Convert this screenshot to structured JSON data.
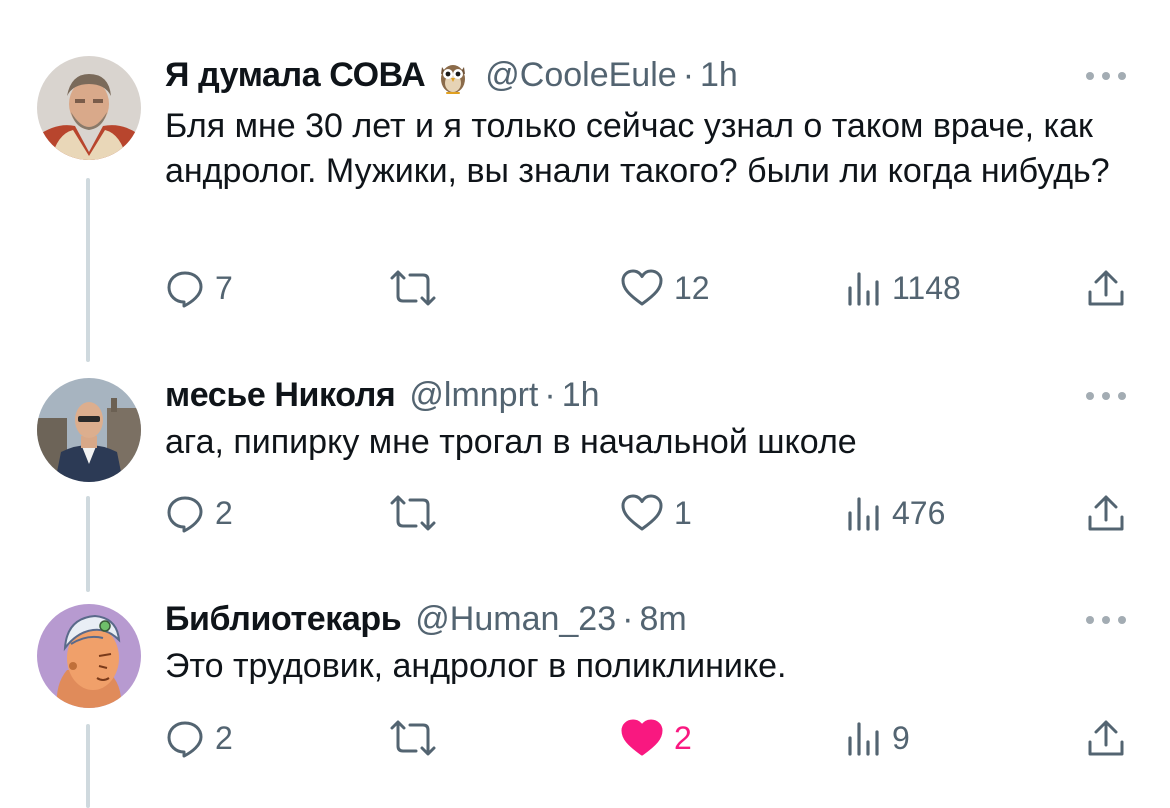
{
  "tweets": [
    {
      "name": "Я думала СОВА",
      "emoji": "owl-emoji",
      "handle": "@CooleEule",
      "separator": "·",
      "time": "1h",
      "text": "Бля мне 30 лет и я только сейчас узнал о таком враче, как андролог. Мужики, вы знали такого? были ли когда нибудь?",
      "replies": "7",
      "retweets": "",
      "likes": "12",
      "liked": false,
      "views": "1148"
    },
    {
      "name": "месье Николя",
      "handle": "@lmnprt",
      "separator": "·",
      "time": "1h",
      "text": "ага, пипирку мне трогал в начальной школе",
      "replies": "2",
      "retweets": "",
      "likes": "1",
      "liked": false,
      "views": "476"
    },
    {
      "name": "Библиотекарь",
      "handle": "@Human_23",
      "separator": "·",
      "time": "8m",
      "text": "Это трудовик, андролог в поликлинике.",
      "replies": "2",
      "retweets": "",
      "likes": "2",
      "liked": true,
      "views": "9"
    }
  ],
  "colors": {
    "text": "#0f1419",
    "secondary": "#536471",
    "thread_line": "#cfd9de",
    "like_active": "#f91880",
    "more_dots": "#a3acb3"
  },
  "icons": [
    "reply-icon",
    "retweet-icon",
    "like-icon",
    "views-icon",
    "share-icon",
    "more-icon"
  ]
}
